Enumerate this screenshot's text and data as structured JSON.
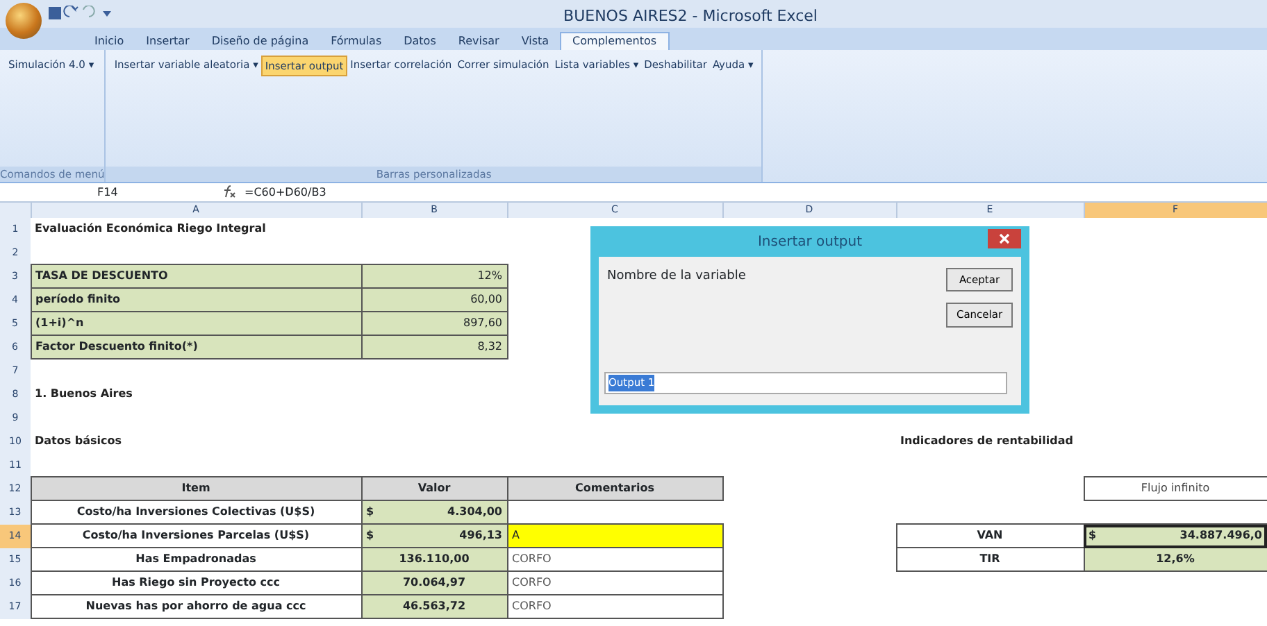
{
  "window": {
    "title": "BUENOS AIRES2 - Microsoft Excel"
  },
  "tabs": [
    {
      "label": "Inicio",
      "selected": false
    },
    {
      "label": "Insertar",
      "selected": false
    },
    {
      "label": "Diseño de página",
      "selected": false
    },
    {
      "label": "Fórmulas",
      "selected": false
    },
    {
      "label": "Datos",
      "selected": false
    },
    {
      "label": "Revisar",
      "selected": false
    },
    {
      "label": "Vista",
      "selected": false
    },
    {
      "label": "Complementos",
      "selected": true
    }
  ],
  "ribbon_groups": [
    {
      "label": "Comandos de menú",
      "buttons": [
        {
          "label": "Simulación 4.0 ▾",
          "selected": false
        }
      ]
    },
    {
      "label": "Barras personalizadas",
      "buttons": [
        {
          "label": "Insertar variable aleatoria ▾",
          "selected": false
        },
        {
          "label": "Insertar output",
          "selected": true
        },
        {
          "label": "Insertar correlación",
          "selected": false
        },
        {
          "label": "Correr simulación",
          "selected": false
        },
        {
          "label": "Lista variables ▾",
          "selected": false
        },
        {
          "label": "Deshabilitar",
          "selected": false
        },
        {
          "label": "Ayuda ▾",
          "selected": false
        }
      ]
    }
  ],
  "formula_bar": {
    "name_box": "F14",
    "formula": "=C60+D60/B3"
  },
  "columns": [
    {
      "label": "A",
      "selected": false
    },
    {
      "label": "B",
      "selected": false
    },
    {
      "label": "C",
      "selected": false
    },
    {
      "label": "D",
      "selected": false
    },
    {
      "label": "E",
      "selected": false
    },
    {
      "label": "F",
      "selected": true
    }
  ],
  "rows": [
    {
      "label": "1",
      "selected": false,
      "cells": {
        "a": {
          "kind": "title",
          "text": "Evaluación Económica Riego Integral"
        }
      }
    },
    {
      "label": "2",
      "selected": false,
      "cells": {}
    },
    {
      "label": "3",
      "selected": false,
      "cells": {
        "a": {
          "kind": "param",
          "text": "TASA DE DESCUENTO"
        },
        "b": {
          "kind": "param-value",
          "text": "12%"
        }
      }
    },
    {
      "label": "4",
      "selected": false,
      "cells": {
        "a": {
          "kind": "param",
          "text": "período finito"
        },
        "b": {
          "kind": "param-value",
          "text": "60,00"
        }
      }
    },
    {
      "label": "5",
      "selected": false,
      "cells": {
        "a": {
          "kind": "param",
          "text": "(1+i)^n"
        },
        "b": {
          "kind": "param-value",
          "text": "897,60"
        }
      }
    },
    {
      "label": "6",
      "selected": false,
      "cells": {
        "a": {
          "kind": "param",
          "text": "Factor Descuento finito(*)"
        },
        "b": {
          "kind": "param-value",
          "text": "8,32"
        }
      }
    },
    {
      "label": "7",
      "selected": false,
      "cells": {}
    },
    {
      "label": "8",
      "selected": false,
      "cells": {
        "a": {
          "kind": "title",
          "text": "1. Buenos Aires"
        }
      }
    },
    {
      "label": "9",
      "selected": false,
      "cells": {}
    },
    {
      "label": "10",
      "selected": false,
      "cells": {
        "a": {
          "kind": "title",
          "text": "Datos básicos"
        },
        "e": {
          "kind": "title",
          "text": "Indicadores de rentabilidad"
        }
      }
    },
    {
      "label": "11",
      "selected": false,
      "cells": {}
    },
    {
      "label": "12",
      "selected": false,
      "cells": {
        "a": {
          "kind": "header",
          "text": "Item"
        },
        "b": {
          "kind": "header",
          "text": "Valor"
        },
        "c": {
          "kind": "header",
          "text": "Comentarios"
        },
        "f": {
          "kind": "boxed",
          "text": "Flujo infinito"
        }
      }
    },
    {
      "label": "13",
      "selected": false,
      "cells": {
        "a": {
          "kind": "item",
          "text": "Costo/ha Inversiones Colectivas (U$S)"
        },
        "b": {
          "kind": "currency",
          "currency": "$",
          "text": "4.304,00"
        }
      }
    },
    {
      "label": "14",
      "selected": true,
      "cells": {
        "a": {
          "kind": "item",
          "text": "Costo/ha Inversiones Parcelas (U$S)"
        },
        "b": {
          "kind": "currency",
          "currency": "$",
          "text": "496,13"
        },
        "c": {
          "kind": "highlight",
          "text": "A"
        },
        "e": {
          "kind": "item",
          "text": "VAN"
        },
        "f": {
          "kind": "currency",
          "currency": "$",
          "text": "34.887.496,0",
          "active": true
        }
      }
    },
    {
      "label": "15",
      "selected": false,
      "cells": {
        "a": {
          "kind": "item",
          "text": "Has Empadronadas"
        },
        "b": {
          "kind": "number",
          "text": "136.110,00"
        },
        "c": {
          "kind": "comment",
          "text": "CORFO"
        },
        "e": {
          "kind": "item",
          "text": "TIR"
        },
        "f": {
          "kind": "number",
          "text": "12,6%"
        }
      }
    },
    {
      "label": "16",
      "selected": false,
      "cells": {
        "a": {
          "kind": "item",
          "text": "Has Riego sin Proyecto ccc"
        },
        "b": {
          "kind": "number",
          "text": "70.064,97"
        },
        "c": {
          "kind": "comment",
          "text": "CORFO"
        }
      }
    },
    {
      "label": "17",
      "selected": false,
      "cells": {
        "a": {
          "kind": "item",
          "text": "Nuevas has por ahorro de agua ccc"
        },
        "b": {
          "kind": "number",
          "text": "46.563,72"
        },
        "c": {
          "kind": "comment",
          "text": "CORFO"
        }
      }
    }
  ],
  "dialog": {
    "title": "Insertar output",
    "label": "Nombre de la variable",
    "buttons": [
      "Aceptar",
      "Cancelar"
    ],
    "value": "Output 1"
  }
}
